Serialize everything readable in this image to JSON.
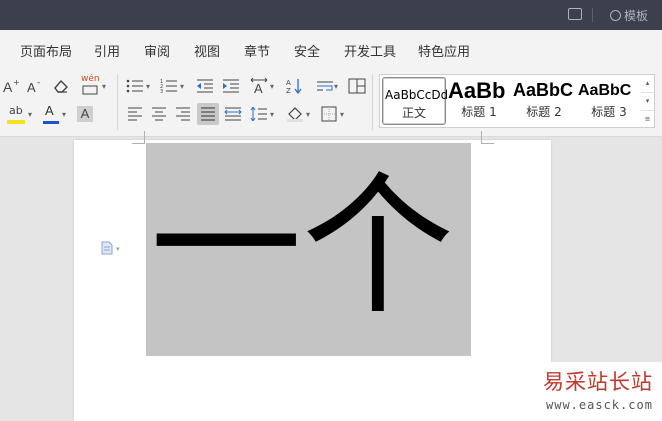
{
  "titlebar": {
    "template_label": "模板"
  },
  "menu": [
    "页面布局",
    "引用",
    "审阅",
    "视图",
    "章节",
    "安全",
    "开发工具",
    "特色应用"
  ],
  "toolbar": {
    "phonetic_label": "wén",
    "highlight_label": "ab",
    "font_color_label": "A",
    "char_shade_label": "A"
  },
  "styles": [
    {
      "sample": "AaBbCcDd",
      "name": "正文"
    },
    {
      "sample": "AaBb",
      "name": "标题 1"
    },
    {
      "sample": "AaBbC",
      "name": "标题 2"
    },
    {
      "sample": "AaBbC",
      "name": "标题 3"
    }
  ],
  "document": {
    "text": "一个"
  },
  "watermark": {
    "main": "易采站长站",
    "sub": "www.easck.com"
  },
  "colors": {
    "highlight": "#f5e31a",
    "font_color": "#1f4fd8"
  }
}
